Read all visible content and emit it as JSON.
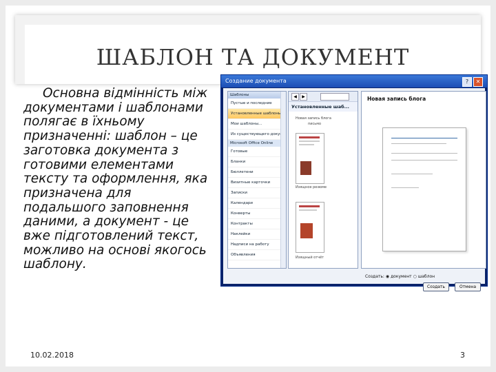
{
  "slide": {
    "title": "ШАБЛОН ТА ДОКУМЕНТ",
    "body": "Основна відмінність між документами і шаблонами полягає в їхньому призначенні: шаблон – це заготовка документа з готовими елементами тексту та оформлення, яка призначена для подальшого заповнення даними, а документ - це вже підготовлений текст, можливо на основі якогось шаблону.",
    "date": "10.02.2018",
    "page_number": "3"
  },
  "dialog": {
    "title": "Создание документа",
    "help_label": "?",
    "close_label": "✕",
    "left_header": "Шаблоны",
    "left_items": [
      {
        "label": "Пустые и последние",
        "selected": false
      },
      {
        "label": "Установленные шаблоны",
        "selected": true
      },
      {
        "label": "Мои шаблоны...",
        "selected": false
      },
      {
        "label": "Из существующего документа...",
        "selected": false
      }
    ],
    "left_section": "Microsoft Office Online",
    "left_online_items": [
      "Готовые",
      "Бланки",
      "Бюллетени",
      "Визитные карточки",
      "Записки",
      "Календари",
      "Конверты",
      "Контракты",
      "Наклейки",
      "Надписи на работу",
      "Объявления"
    ],
    "middle_header": "Установленные шаб...",
    "thumb_labels": [
      "Новая запись блога",
      "письмо",
      "Изящное резюме",
      "Изящный отчёт"
    ],
    "preview_title": "Новая запись блога",
    "create_new_label": "Создать",
    "option_document": "документ",
    "option_template": "шаблон",
    "create_button": "Создать",
    "cancel_button": "Отмена"
  }
}
